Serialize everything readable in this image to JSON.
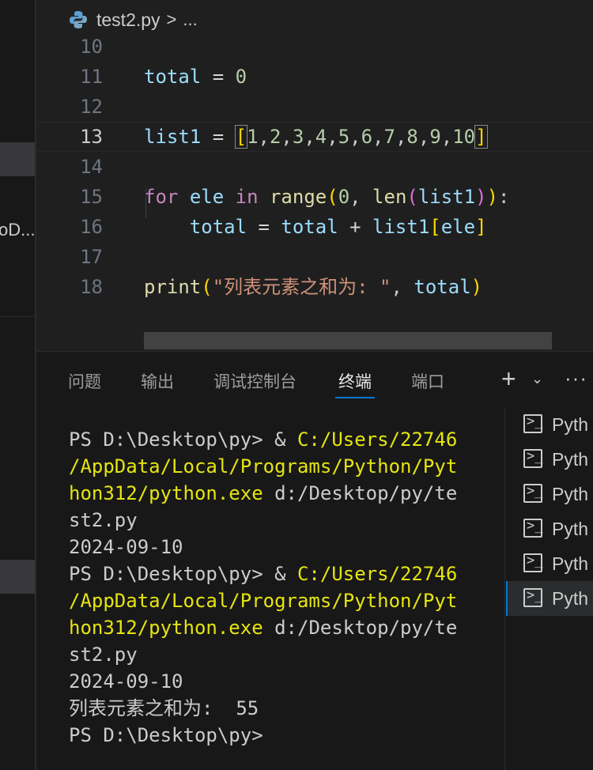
{
  "breadcrumb": {
    "file": "test2.py",
    "separator": ">",
    "more": "..."
  },
  "left_panel": {
    "truncated_label": "oD..."
  },
  "editor": {
    "current_line": 13,
    "lines": [
      {
        "num": "10",
        "text": ""
      },
      {
        "num": "11",
        "text": "total = 0"
      },
      {
        "num": "12",
        "text": ""
      },
      {
        "num": "13",
        "text": "list1 = [1,2,3,4,5,6,7,8,9,10]"
      },
      {
        "num": "14",
        "text": ""
      },
      {
        "num": "15",
        "text": "for ele in range(0, len(list1)):"
      },
      {
        "num": "16",
        "text": "    total = total + list1[ele]"
      },
      {
        "num": "17",
        "text": ""
      },
      {
        "num": "18",
        "text": "print(\"列表元素之和为: \", total)"
      }
    ]
  },
  "panel": {
    "tabs": [
      "问题",
      "输出",
      "调试控制台",
      "终端",
      "端口"
    ],
    "active_tab": "终端",
    "plus_label": "+",
    "dropdown_label": "⌄",
    "more_label": "···"
  },
  "terminal": {
    "lines": [
      "PS D:\\Desktop\\py> & C:/Users/22746",
      "/AppData/Local/Programs/Python/Pyt",
      "hon312/python.exe d:/Desktop/py/te",
      "st2.py",
      "2024-09-10",
      "PS D:\\Desktop\\py> & C:/Users/22746",
      "/AppData/Local/Programs/Python/Pyt",
      "hon312/python.exe d:/Desktop/py/te",
      "st2.py",
      "2024-09-10",
      "列表元素之和为:  55",
      "PS D:\\Desktop\\py>"
    ],
    "instances": [
      "Pyth",
      "Pyth",
      "Pyth",
      "Pyth",
      "Pyth",
      "Pyth"
    ],
    "active_instance": 5
  },
  "colors": {
    "accent": "#0078d4",
    "editor_bg": "#1f1f1f",
    "panel_bg": "#181818",
    "terminal_yellow": "#e5e510"
  }
}
